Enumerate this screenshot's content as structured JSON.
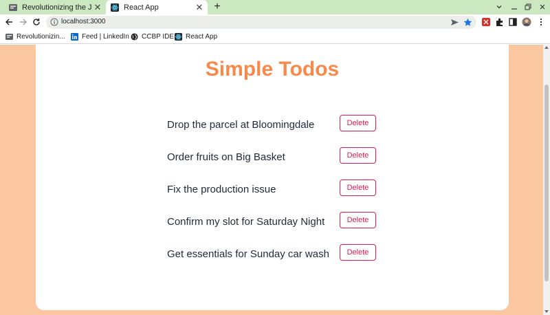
{
  "browser": {
    "tabs": [
      {
        "title": "Revolutionizing the Job M",
        "active": false
      },
      {
        "title": "React App",
        "active": true
      }
    ],
    "url": "localhost:3000",
    "bookmarks": [
      {
        "label": "Revolutionizin...",
        "icon": "site-favicon"
      },
      {
        "label": "Feed | LinkedIn",
        "icon": "linkedin-icon"
      },
      {
        "label": "CCBP IDE",
        "icon": "globe-icon"
      },
      {
        "label": "React App",
        "icon": "react-icon"
      }
    ]
  },
  "app": {
    "title": "Simple Todos",
    "delete_label": "Delete",
    "todos": [
      {
        "text": "Drop the parcel at Bloomingdale"
      },
      {
        "text": "Order fruits on Big Basket"
      },
      {
        "text": "Fix the production issue"
      },
      {
        "text": "Confirm my slot for Saturday Night"
      },
      {
        "text": "Get essentials for Sunday car wash"
      }
    ]
  },
  "colors": {
    "background": "#fbc7a1",
    "heading": "#f7894a",
    "delete": "#e31a4e",
    "tab_strip": "#cce8c0"
  }
}
